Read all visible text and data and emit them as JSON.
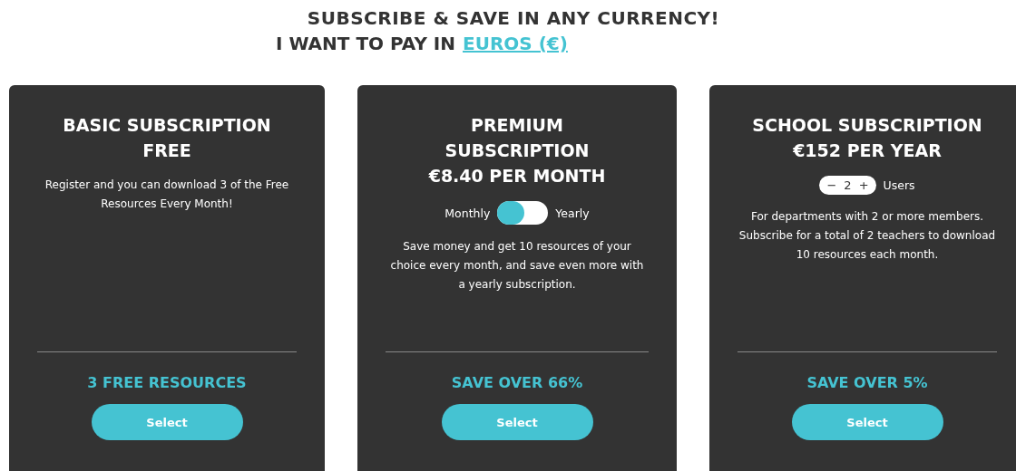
{
  "header": {
    "title": "SUBSCRIBE & SAVE IN ANY CURRENCY!",
    "currency_prompt": "I WANT TO PAY IN",
    "currency_link": "EUROS (€)"
  },
  "plans": [
    {
      "kind": "basic",
      "title": "BASIC SUBSCRIPTION",
      "price": "FREE",
      "description": "Register and you can download 3 of the Free Resources Every Month!",
      "highlight": "3 FREE RESOURCES",
      "button": "Select"
    },
    {
      "kind": "premium",
      "title": "PREMIUM SUBSCRIPTION",
      "price": "€8.40 PER MONTH",
      "toggle": {
        "left": "Monthly",
        "right": "Yearly",
        "on": false
      },
      "description": "Save money and get 10 resources of your choice every month, and save even more with a yearly subscription.",
      "highlight": "SAVE OVER 66%",
      "button": "Select"
    },
    {
      "kind": "school",
      "title": "SCHOOL SUBSCRIPTION",
      "price": "€152 PER YEAR",
      "stepper": {
        "minus": "−",
        "value": "2",
        "plus": "+",
        "label": "Users"
      },
      "description": "For departments with 2 or more members. Subscribe for a total of 2 teachers to download 10 resources each month.",
      "highlight": "SAVE OVER 5%",
      "button": "Select"
    }
  ]
}
